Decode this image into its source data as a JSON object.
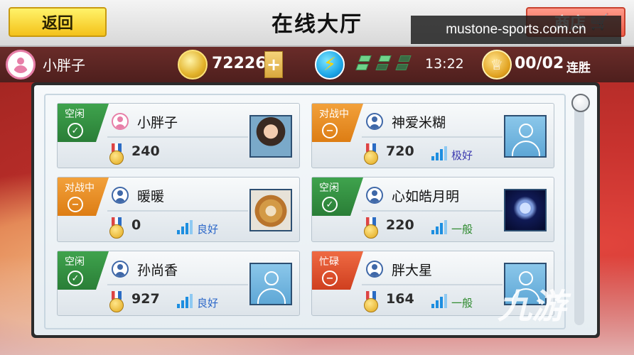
{
  "header": {
    "back_label": "返回",
    "title": "在线大厅",
    "shop_label": "商店",
    "watermark": "mustone-sports.com.cn"
  },
  "status": {
    "player_name": "小胖子",
    "coins": "72226",
    "plus_label": "+",
    "energy_filled": 3,
    "energy_total": 6,
    "timer": "13:22",
    "streak": "00/02",
    "streak_label": "连胜"
  },
  "players": [
    {
      "status": "空闲",
      "status_type": "idle",
      "name": "小胖子",
      "score": "240",
      "signal": "",
      "photo": "girl",
      "self": true
    },
    {
      "status": "对战中",
      "status_type": "battle",
      "name": "神爱米糊",
      "score": "720",
      "signal": "极好",
      "photo": "default"
    },
    {
      "status": "对战中",
      "status_type": "battle",
      "name": "暖暖",
      "score": "0",
      "signal": "良好",
      "photo": "dog"
    },
    {
      "status": "空闲",
      "status_type": "idle",
      "name": "心如皓月明",
      "score": "220",
      "signal": "一般",
      "photo": "moon"
    },
    {
      "status": "空闲",
      "status_type": "idle",
      "name": "孙尚香",
      "score": "927",
      "signal": "良好",
      "photo": "default"
    },
    {
      "status": "忙碌",
      "status_type": "busy",
      "name": "胖大星",
      "score": "164",
      "signal": "一般",
      "photo": "default"
    }
  ],
  "colors": {
    "idle": "#2f8a3d",
    "battle": "#e58a22",
    "busy": "#d94a2a",
    "signal_excellent": "#3d3bb0",
    "signal_good": "#2a66c8",
    "signal_fair": "#2e8a2e"
  },
  "corner_logo": "九游"
}
